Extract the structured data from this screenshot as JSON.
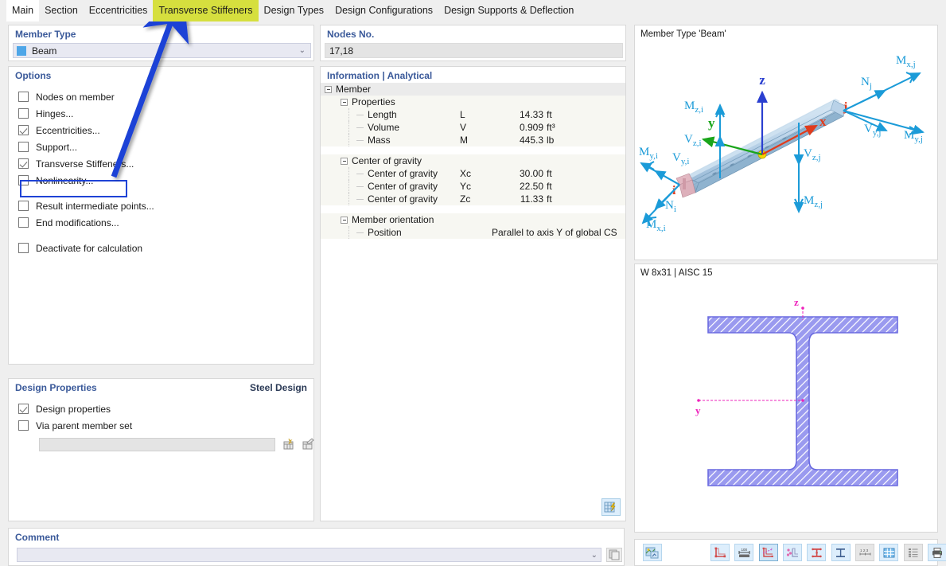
{
  "tabs": [
    {
      "label": "Main",
      "state": "active"
    },
    {
      "label": "Section",
      "state": "normal"
    },
    {
      "label": "Eccentricities",
      "state": "normal"
    },
    {
      "label": "Transverse Stiffeners",
      "state": "highlight"
    },
    {
      "label": "Design Types",
      "state": "normal"
    },
    {
      "label": "Design Configurations",
      "state": "normal"
    },
    {
      "label": "Design Supports & Deflection",
      "state": "normal"
    }
  ],
  "member_type": {
    "title": "Member Type",
    "selected": "Beam",
    "swatch_color": "#4ea6e8",
    "chevron": "⌄"
  },
  "options": {
    "title": "Options",
    "items": [
      {
        "label": "Nodes on member",
        "checked": false
      },
      {
        "label": "Hinges...",
        "checked": false
      },
      {
        "label": "Eccentricities...",
        "checked": true
      },
      {
        "label": "Support...",
        "checked": false
      },
      {
        "label": "Transverse Stiffeners...",
        "checked": true,
        "highlighted": true
      },
      {
        "label": "Nonlinearity...",
        "checked": false
      }
    ],
    "items2": [
      {
        "label": "Result intermediate points...",
        "checked": false
      },
      {
        "label": "End modifications...",
        "checked": false
      }
    ],
    "items3": [
      {
        "label": "Deactivate for calculation",
        "checked": false
      }
    ]
  },
  "design_properties": {
    "title": "Design Properties",
    "right_label": "Steel Design",
    "items": [
      {
        "label": "Design properties",
        "checked": true
      },
      {
        "label": "Via parent member set",
        "checked": false
      }
    ],
    "field_value": "",
    "button_new_icon": "new-member-set-icon",
    "button_edit_icon": "edit-member-set-icon"
  },
  "comment": {
    "title": "Comment",
    "value": "",
    "chevron": "⌄",
    "copy_icon": "copy-icon"
  },
  "nodes": {
    "title": "Nodes No.",
    "value": "17,18"
  },
  "information": {
    "title": "Information | Analytical",
    "root": "Member",
    "groups": [
      {
        "name": "Properties",
        "rows": [
          {
            "label": "Length",
            "symbol": "L",
            "value": "14.33",
            "unit": "ft"
          },
          {
            "label": "Volume",
            "symbol": "V",
            "value": "0.909",
            "unit": "ft³"
          },
          {
            "label": "Mass",
            "symbol": "M",
            "value": "445.3",
            "unit": "lb"
          }
        ]
      },
      {
        "name": "Center of gravity",
        "rows": [
          {
            "label": "Center of gravity",
            "symbol": "Xc",
            "value": "30.00",
            "unit": "ft"
          },
          {
            "label": "Center of gravity",
            "symbol": "Yc",
            "value": "22.50",
            "unit": "ft"
          },
          {
            "label": "Center of gravity",
            "symbol": "Zc",
            "value": "11.33",
            "unit": "ft"
          }
        ]
      },
      {
        "name": "Member orientation",
        "rows": [
          {
            "label": "Position",
            "symbol": "",
            "value": "Parallel to axis Y of global CS",
            "unit": "",
            "wide": true
          }
        ]
      }
    ],
    "table_icon": "table-lightning-icon"
  },
  "member_view": {
    "caption": "Member Type 'Beam'",
    "axes": [
      {
        "name": "z",
        "color": "#2a3fd0"
      },
      {
        "name": "y",
        "color": "#1aa51a"
      },
      {
        "name": "x",
        "color": "#e03b1c"
      }
    ],
    "node_labels": [
      {
        "name": "i",
        "color": "#e03b1c"
      },
      {
        "name": "j",
        "color": "#e03b1c"
      }
    ],
    "force_labels": [
      "M_z,i",
      "V_z,i",
      "M_y,i",
      "V_y,i",
      "N_i",
      "M_x,i",
      "N_j",
      "M_x,j",
      "V_y,j",
      "M_y,j",
      "V_z,j",
      "M_z,j"
    ],
    "arrow_color": "#1b9bd8"
  },
  "section_view": {
    "caption": "W 8x31 | AISC 15",
    "axis_z": "z",
    "axis_y": "y",
    "section_color": "#7a7ae8",
    "axis_color": "#ee22bb"
  },
  "section_toolbar": {
    "left_button": "render-section-icon",
    "buttons": [
      {
        "icon": "section-outline-icon",
        "state": "normal"
      },
      {
        "icon": "dimensions-icon",
        "state": "normal"
      },
      {
        "icon": "principal-axes-icon",
        "state": "selected"
      },
      {
        "icon": "stress-points-icon",
        "state": "normal"
      },
      {
        "icon": "section-parts-icon",
        "state": "normal"
      },
      {
        "icon": "section-shape-icon",
        "state": "normal"
      },
      {
        "icon": "numbering-icon",
        "state": "disabled"
      },
      {
        "icon": "grid-icon",
        "state": "normal"
      },
      {
        "icon": "table-list-icon",
        "state": "disabled"
      },
      {
        "icon": "print-icon",
        "state": "normal",
        "has_dropdown": true
      },
      {
        "icon": "zoom-reset-icon",
        "state": "normal"
      }
    ]
  },
  "annotation": {
    "arrow_color": "#1f43d6",
    "highlight_box_color": "#1f43d6"
  }
}
